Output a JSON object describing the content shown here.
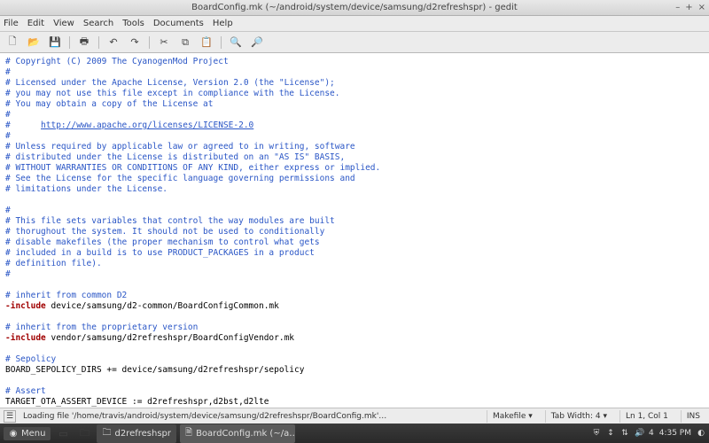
{
  "window": {
    "title": "BoardConfig.mk (~/android/system/device/samsung/d2refreshspr) - gedit",
    "controls": {
      "min": "–",
      "max": "+",
      "close": "×"
    }
  },
  "menu": [
    "File",
    "Edit",
    "View",
    "Search",
    "Tools",
    "Documents",
    "Help"
  ],
  "code": {
    "l1": "# Copyright (C) 2009 The CyanogenMod Project",
    "l2": "#",
    "l3": "# Licensed under the Apache License, Version 2.0 (the \"License\");",
    "l4": "# you may not use this file except in compliance with the License.",
    "l5": "# You may obtain a copy of the License at",
    "l6": "#",
    "l7a": "#      ",
    "l7b": "http://www.apache.org/licenses/LICENSE-2.0",
    "l8": "#",
    "l9": "# Unless required by applicable law or agreed to in writing, software",
    "l10": "# distributed under the License is distributed on an \"AS IS\" BASIS,",
    "l11": "# WITHOUT WARRANTIES OR CONDITIONS OF ANY KIND, either express or implied.",
    "l12": "# See the License for the specific language governing permissions and",
    "l13": "# limitations under the License.",
    "l14": "#",
    "l15": "# This file sets variables that control the way modules are built",
    "l16": "# thorughout the system. It should not be used to conditionally",
    "l17": "# disable makefiles (the proper mechanism to control what gets",
    "l18": "# included in a build is to use PRODUCT_PACKAGES in a product",
    "l19": "# definition file).",
    "l20": "#",
    "l21": "# inherit from common D2",
    "l22a": "-include",
    "l22b": " device/samsung/d2-common/BoardConfigCommon.mk",
    "l23": "# inherit from the proprietary version",
    "l24a": "-include",
    "l24b": " vendor/samsung/d2refreshspr/BoardConfigVendor.mk",
    "l25": "# Sepolicy",
    "l26": "BOARD_SEPOLICY_DIRS += device/samsung/d2refreshspr/sepolicy",
    "l27": "# Assert",
    "l28": "TARGET_OTA_ASSERT_DEVICE := d2refreshspr,d2bst,d2lte"
  },
  "status": {
    "loading": "Loading file '/home/travis/android/system/device/samsung/d2refreshspr/BoardConfig.mk'…",
    "lang": "Makefile ▾",
    "tab": "Tab Width: 4 ▾",
    "pos": "Ln 1, Col 1",
    "ins": "INS"
  },
  "taskbar": {
    "menu": "Menu",
    "task1": "d2refreshspr",
    "task2": "BoardConfig.mk (~/a…",
    "ws": "4",
    "time": "4:35 PM"
  }
}
